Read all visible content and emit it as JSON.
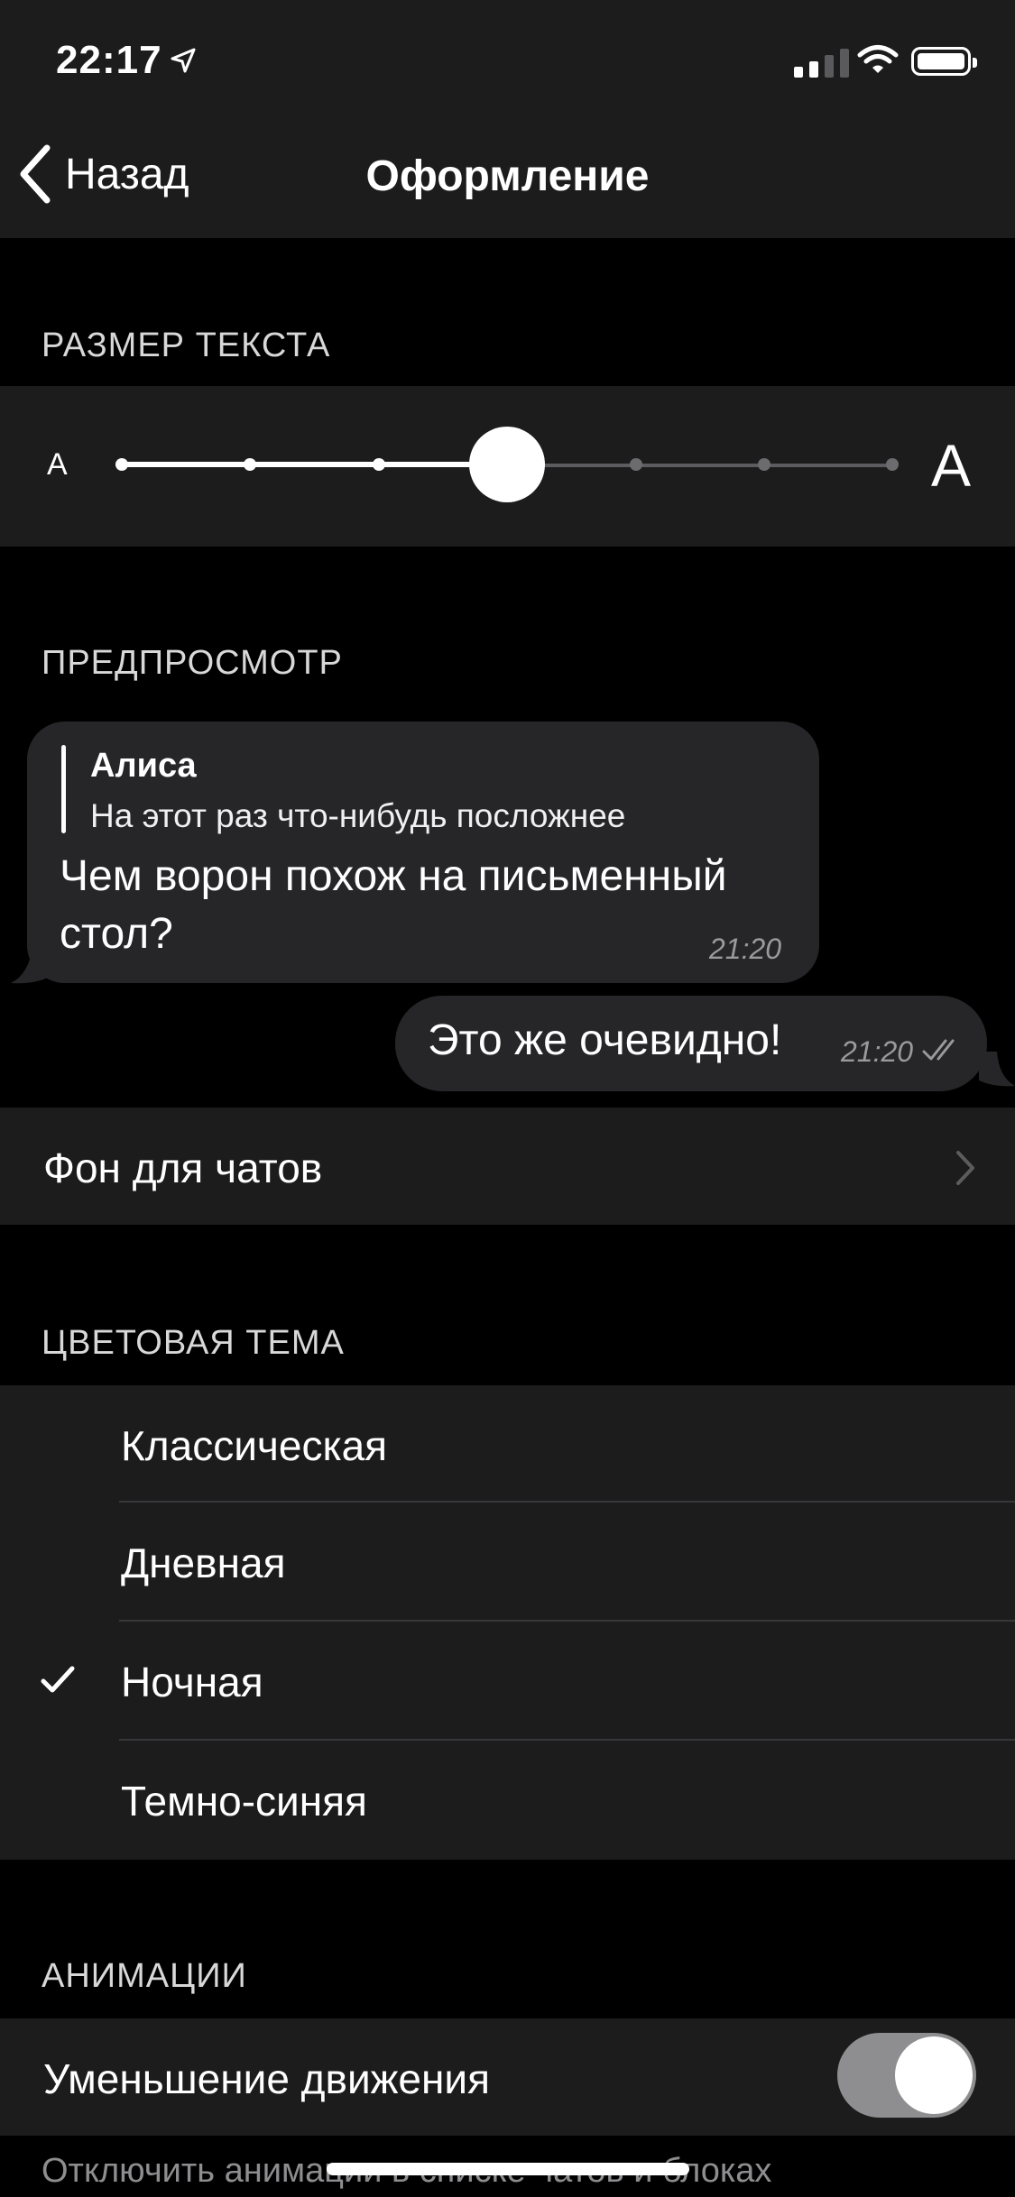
{
  "status_bar": {
    "time": "22:17"
  },
  "nav": {
    "back_label": "Назад",
    "title": "Оформление"
  },
  "text_size": {
    "header": "РАЗМЕР ТЕКСТА",
    "small_label": "A",
    "large_label": "A",
    "selected_step": 4,
    "total_steps": 7
  },
  "preview": {
    "header": "ПРЕДПРОСМОТР",
    "incoming": {
      "reply_name": "Алиса",
      "reply_text": "На этот раз что-нибудь посложнее",
      "text": "Чем ворон похож на письменный стол?",
      "time": "21:20"
    },
    "outgoing": {
      "text": "Это же очевидно!",
      "time": "21:20"
    }
  },
  "chat_background": {
    "label": "Фон для чатов"
  },
  "color_theme": {
    "header": "ЦВЕТОВАЯ ТЕМА",
    "options": [
      "Классическая",
      "Дневная",
      "Ночная",
      "Темно-синяя"
    ],
    "selected": "Ночная"
  },
  "animations": {
    "header": "АНИМАЦИИ",
    "reduce_motion_label": "Уменьшение движения",
    "reduce_motion_on": false,
    "footnote": "Отключить анимации в списке чатов и блоках"
  },
  "colors": {
    "background": "#000000",
    "panel": "#1c1c1d",
    "bubble": "#262628",
    "toggle_off": "#8e8e90"
  }
}
